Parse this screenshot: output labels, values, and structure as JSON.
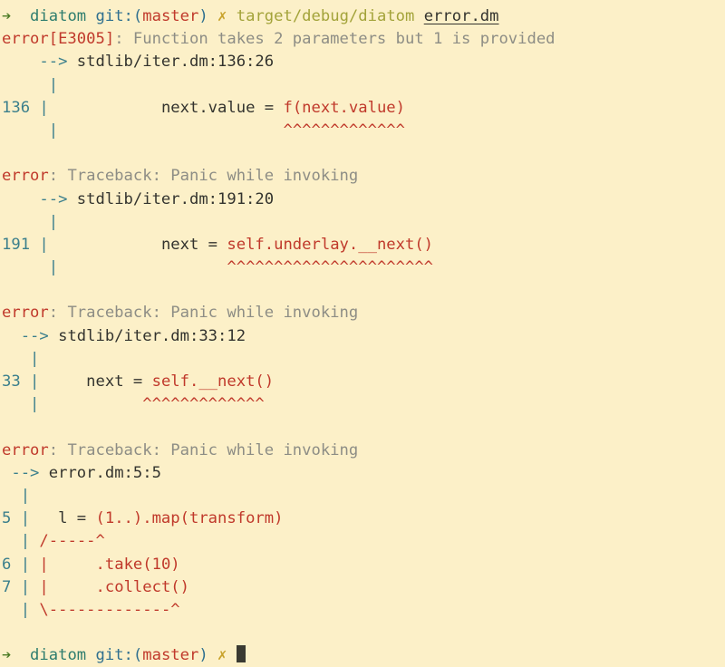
{
  "terminal": {
    "background_color": "#fcf0c8",
    "palette": {
      "prompt_arrow": "#4a7a23",
      "prompt_user": "#2e7d6e",
      "git_branch_paren": "#2f6f8f",
      "git_branch_name": "#c0392b",
      "git_dirty_mark": "#c8a22a",
      "command_path": "#a3a33a",
      "command_arg": "#33332e",
      "error_label": "#c0392b",
      "message_text": "#8d8d85",
      "line_number": "#3b7f8c",
      "gutter_pipe": "#3b7f8c",
      "source_code": "#33332e",
      "highlight_code": "#c0392b",
      "caret_underline": "#c0392b",
      "cursor": "#3a3a32"
    },
    "prompt": {
      "arrow": "➔",
      "user": "diatom",
      "git_open": "git:(",
      "git_branch": "master",
      "git_close": ")",
      "dirty": "✗"
    },
    "command": {
      "binary": "target/debug/diatom",
      "argument": "error.dm"
    },
    "cursor_glyph": "█",
    "lines": [
      {
        "name": "prompt-line-command",
        "type": "prompt",
        "segs": [
          {
            "text": "➔ ",
            "cls": "c-green",
            "name": "prompt-arrow-icon"
          },
          {
            "text": " diatom ",
            "cls": "c-teal",
            "name": "prompt-user"
          },
          {
            "text": "git:(",
            "cls": "c-blue",
            "name": "git-paren-open"
          },
          {
            "text": "master",
            "cls": "c-red",
            "name": "git-branch-name"
          },
          {
            "text": ")",
            "cls": "c-blue",
            "name": "git-paren-close"
          },
          {
            "text": " ✗ ",
            "cls": "c-yellow",
            "name": "git-dirty-icon"
          },
          {
            "text": "target/debug/diatom ",
            "cls": "c-olive",
            "name": "command-binary"
          },
          {
            "text": "error.dm",
            "cls": "c-dark underline",
            "name": "command-argument"
          }
        ]
      },
      {
        "name": "error-header-e3005",
        "type": "error-header",
        "segs": [
          {
            "text": "error[E3005]",
            "cls": "c-red",
            "name": "error-code-label"
          },
          {
            "text": ": Function takes 2 parameters but 1 is provided",
            "cls": "c-gray",
            "name": "error-message"
          }
        ]
      },
      {
        "name": "location-arrow-136",
        "type": "location",
        "segs": [
          {
            "text": "    ",
            "cls": "",
            "name": "indent"
          },
          {
            "text": "-->",
            "cls": "c-linenum",
            "name": "location-arrow-icon"
          },
          {
            "text": " stdlib/iter.dm:136:26",
            "cls": "c-dark",
            "name": "location-path"
          }
        ]
      },
      {
        "name": "gutter-blank-136-top",
        "type": "gutter",
        "segs": [
          {
            "text": "     ",
            "cls": "",
            "name": "indent"
          },
          {
            "text": "|",
            "cls": "c-pipe",
            "name": "gutter-pipe"
          }
        ]
      },
      {
        "name": "source-line-136",
        "type": "source",
        "segs": [
          {
            "text": "136 ",
            "cls": "c-linenum",
            "name": "line-number"
          },
          {
            "text": "|",
            "cls": "c-pipe",
            "name": "gutter-pipe"
          },
          {
            "text": "            next.value = ",
            "cls": "c-dark",
            "name": "source-code"
          },
          {
            "text": "f(next.value)",
            "cls": "c-red",
            "name": "source-code-highlighted"
          }
        ]
      },
      {
        "name": "caret-line-136",
        "type": "caret",
        "segs": [
          {
            "text": "     ",
            "cls": "",
            "name": "indent"
          },
          {
            "text": "|",
            "cls": "c-pipe",
            "name": "gutter-pipe"
          },
          {
            "text": "                        ",
            "cls": "",
            "name": "caret-pad"
          },
          {
            "text": "^^^^^^^^^^^^^",
            "cls": "c-red",
            "name": "caret-underline"
          }
        ]
      },
      {
        "name": "blank-1",
        "type": "blank",
        "segs": []
      },
      {
        "name": "error-header-traceback-1",
        "type": "error-header",
        "segs": [
          {
            "text": "error",
            "cls": "c-red",
            "name": "error-label"
          },
          {
            "text": ": Traceback: Panic while invoking",
            "cls": "c-gray",
            "name": "error-message"
          }
        ]
      },
      {
        "name": "location-arrow-191",
        "type": "location",
        "segs": [
          {
            "text": "    ",
            "cls": "",
            "name": "indent"
          },
          {
            "text": "-->",
            "cls": "c-linenum",
            "name": "location-arrow-icon"
          },
          {
            "text": " stdlib/iter.dm:191:20",
            "cls": "c-dark",
            "name": "location-path"
          }
        ]
      },
      {
        "name": "gutter-blank-191-top",
        "type": "gutter",
        "segs": [
          {
            "text": "     ",
            "cls": "",
            "name": "indent"
          },
          {
            "text": "|",
            "cls": "c-pipe",
            "name": "gutter-pipe"
          }
        ]
      },
      {
        "name": "source-line-191",
        "type": "source",
        "segs": [
          {
            "text": "191 ",
            "cls": "c-linenum",
            "name": "line-number"
          },
          {
            "text": "|",
            "cls": "c-pipe",
            "name": "gutter-pipe"
          },
          {
            "text": "            next = ",
            "cls": "c-dark",
            "name": "source-code"
          },
          {
            "text": "self.underlay.__next()",
            "cls": "c-red",
            "name": "source-code-highlighted"
          }
        ]
      },
      {
        "name": "caret-line-191",
        "type": "caret",
        "segs": [
          {
            "text": "     ",
            "cls": "",
            "name": "indent"
          },
          {
            "text": "|",
            "cls": "c-pipe",
            "name": "gutter-pipe"
          },
          {
            "text": "                  ",
            "cls": "",
            "name": "caret-pad"
          },
          {
            "text": "^^^^^^^^^^^^^^^^^^^^^^",
            "cls": "c-red",
            "name": "caret-underline"
          }
        ]
      },
      {
        "name": "blank-2",
        "type": "blank",
        "segs": []
      },
      {
        "name": "error-header-traceback-2",
        "type": "error-header",
        "segs": [
          {
            "text": "error",
            "cls": "c-red",
            "name": "error-label"
          },
          {
            "text": ": Traceback: Panic while invoking",
            "cls": "c-gray",
            "name": "error-message"
          }
        ]
      },
      {
        "name": "location-arrow-33",
        "type": "location",
        "segs": [
          {
            "text": "  ",
            "cls": "",
            "name": "indent"
          },
          {
            "text": "-->",
            "cls": "c-linenum",
            "name": "location-arrow-icon"
          },
          {
            "text": " stdlib/iter.dm:33:12",
            "cls": "c-dark",
            "name": "location-path"
          }
        ]
      },
      {
        "name": "gutter-blank-33-top",
        "type": "gutter",
        "segs": [
          {
            "text": "   ",
            "cls": "",
            "name": "indent"
          },
          {
            "text": "|",
            "cls": "c-pipe",
            "name": "gutter-pipe"
          }
        ]
      },
      {
        "name": "source-line-33",
        "type": "source",
        "segs": [
          {
            "text": "33 ",
            "cls": "c-linenum",
            "name": "line-number"
          },
          {
            "text": "|",
            "cls": "c-pipe",
            "name": "gutter-pipe"
          },
          {
            "text": "     next = ",
            "cls": "c-dark",
            "name": "source-code"
          },
          {
            "text": "self.__next()",
            "cls": "c-red",
            "name": "source-code-highlighted"
          }
        ]
      },
      {
        "name": "caret-line-33",
        "type": "caret",
        "segs": [
          {
            "text": "   ",
            "cls": "",
            "name": "indent"
          },
          {
            "text": "|",
            "cls": "c-pipe",
            "name": "gutter-pipe"
          },
          {
            "text": "           ",
            "cls": "",
            "name": "caret-pad"
          },
          {
            "text": "^^^^^^^^^^^^^",
            "cls": "c-red",
            "name": "caret-underline"
          }
        ]
      },
      {
        "name": "blank-3",
        "type": "blank",
        "segs": []
      },
      {
        "name": "error-header-traceback-3",
        "type": "error-header",
        "segs": [
          {
            "text": "error",
            "cls": "c-red",
            "name": "error-label"
          },
          {
            "text": ": Traceback: Panic while invoking",
            "cls": "c-gray",
            "name": "error-message"
          }
        ]
      },
      {
        "name": "location-arrow-5",
        "type": "location",
        "segs": [
          {
            "text": " ",
            "cls": "",
            "name": "indent"
          },
          {
            "text": "-->",
            "cls": "c-linenum",
            "name": "location-arrow-icon"
          },
          {
            "text": " error.dm:5:5",
            "cls": "c-dark",
            "name": "location-path"
          }
        ]
      },
      {
        "name": "gutter-blank-5-top",
        "type": "gutter",
        "segs": [
          {
            "text": "  ",
            "cls": "",
            "name": "indent"
          },
          {
            "text": "|",
            "cls": "c-pipe",
            "name": "gutter-pipe"
          }
        ]
      },
      {
        "name": "source-line-5",
        "type": "source",
        "segs": [
          {
            "text": "5 ",
            "cls": "c-linenum",
            "name": "line-number"
          },
          {
            "text": "|",
            "cls": "c-pipe",
            "name": "gutter-pipe"
          },
          {
            "text": "   l = ",
            "cls": "c-dark",
            "name": "source-code"
          },
          {
            "text": "(1..).map(transform)",
            "cls": "c-red",
            "name": "source-code-highlighted"
          }
        ]
      },
      {
        "name": "multiline-span-open",
        "type": "span",
        "segs": [
          {
            "text": "  ",
            "cls": "",
            "name": "indent"
          },
          {
            "text": "|",
            "cls": "c-pipe",
            "name": "gutter-pipe"
          },
          {
            "text": " ",
            "cls": "",
            "name": "pad"
          },
          {
            "text": "/-----^",
            "cls": "c-red",
            "name": "span-open-marker"
          }
        ]
      },
      {
        "name": "source-line-6",
        "type": "source",
        "segs": [
          {
            "text": "6 ",
            "cls": "c-linenum",
            "name": "line-number"
          },
          {
            "text": "|",
            "cls": "c-pipe",
            "name": "gutter-pipe"
          },
          {
            "text": " ",
            "cls": "",
            "name": "pad"
          },
          {
            "text": "|",
            "cls": "c-red",
            "name": "span-bar"
          },
          {
            "text": "     .take(10)",
            "cls": "c-red",
            "name": "source-code-highlighted"
          }
        ]
      },
      {
        "name": "source-line-7",
        "type": "source",
        "segs": [
          {
            "text": "7 ",
            "cls": "c-linenum",
            "name": "line-number"
          },
          {
            "text": "|",
            "cls": "c-pipe",
            "name": "gutter-pipe"
          },
          {
            "text": " ",
            "cls": "",
            "name": "pad"
          },
          {
            "text": "|",
            "cls": "c-red",
            "name": "span-bar"
          },
          {
            "text": "     .collect()",
            "cls": "c-red",
            "name": "source-code-highlighted"
          }
        ]
      },
      {
        "name": "multiline-span-close",
        "type": "span",
        "segs": [
          {
            "text": "  ",
            "cls": "",
            "name": "indent"
          },
          {
            "text": "|",
            "cls": "c-pipe",
            "name": "gutter-pipe"
          },
          {
            "text": " ",
            "cls": "",
            "name": "pad"
          },
          {
            "text": "\\-------------^",
            "cls": "c-red",
            "name": "span-close-marker"
          }
        ]
      },
      {
        "name": "blank-4",
        "type": "blank",
        "segs": []
      },
      {
        "name": "prompt-line-final",
        "type": "prompt",
        "segs": [
          {
            "text": "➔ ",
            "cls": "c-green",
            "name": "prompt-arrow-icon"
          },
          {
            "text": " diatom ",
            "cls": "c-teal",
            "name": "prompt-user"
          },
          {
            "text": "git:(",
            "cls": "c-blue",
            "name": "git-paren-open"
          },
          {
            "text": "master",
            "cls": "c-red",
            "name": "git-branch-name"
          },
          {
            "text": ")",
            "cls": "c-blue",
            "name": "git-paren-close"
          },
          {
            "text": " ✗ ",
            "cls": "c-yellow",
            "name": "git-dirty-icon"
          },
          {
            "text": "",
            "cls": "cursor-slot",
            "name": "text-cursor"
          }
        ]
      }
    ]
  }
}
